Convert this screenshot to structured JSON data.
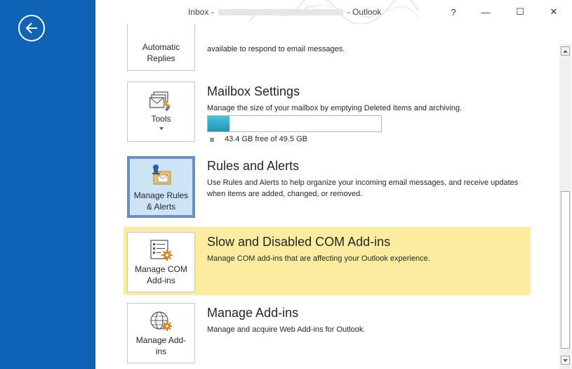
{
  "window": {
    "title_prefix": "Inbox -",
    "title_suffix": "-  Outlook",
    "help_label": "?",
    "minimize_label": "—",
    "restore_label": "☐",
    "close_label": "✕"
  },
  "sections": {
    "auto_replies": {
      "button_label_line1": "Automatic",
      "button_label_line2": "Replies",
      "description": "available to respond to email messages."
    },
    "mailbox_settings": {
      "button_label": "Tools",
      "title": "Mailbox Settings",
      "description": "Manage the size of your mailbox by emptying Deleted Items and archiving.",
      "usage_fraction": 0.124,
      "free_text": "43.4 GB free of 49.5 GB"
    },
    "rules_alerts": {
      "button_label_line1": "Manage Rules",
      "button_label_line2": "& Alerts",
      "title": "Rules and Alerts",
      "description": "Use Rules and Alerts to help organize your incoming email messages, and receive updates when items are added, changed, or removed."
    },
    "com_addins": {
      "button_label_line1": "Manage COM",
      "button_label_line2": "Add-ins",
      "title": "Slow and Disabled COM Add-ins",
      "description": "Manage COM add-ins that are affecting your Outlook experience."
    },
    "addins": {
      "button_label_line1": "Manage Add-",
      "button_label_line2": "ins",
      "title": "Manage Add-ins",
      "description": "Manage and acquire Web Add-ins for Outlook."
    }
  },
  "colors": {
    "sidebar_blue": "#0f63b6",
    "highlight_yellow": "#fcec9f",
    "selected_tile_bg": "#cde4f7",
    "selected_tile_border": "#6b8fbe",
    "progress_fill": "#29aac8"
  }
}
